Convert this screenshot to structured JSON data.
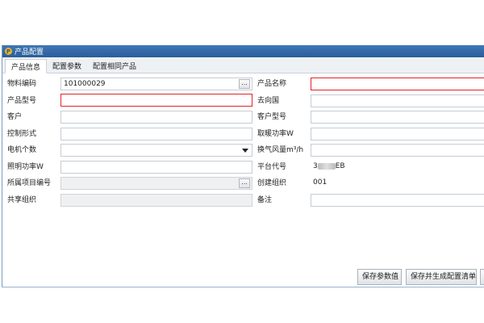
{
  "window": {
    "title": "产品配置",
    "logo_letter": "P"
  },
  "tabs": [
    {
      "label": "产品信息",
      "active": true
    },
    {
      "label": "配置参数",
      "active": false
    },
    {
      "label": "配置相同产品",
      "active": false
    }
  ],
  "fields": {
    "material_code": {
      "label": "物料编码",
      "value": "101000029",
      "button": "..."
    },
    "product_name": {
      "label": "产品名称",
      "value": ""
    },
    "product_model": {
      "label": "产品型号",
      "value": ""
    },
    "destination_country": {
      "label": "去向国",
      "value": ""
    },
    "customer": {
      "label": "客户",
      "value": ""
    },
    "customer_model": {
      "label": "客户型号",
      "value": ""
    },
    "control_form": {
      "label": "控制形式",
      "value": ""
    },
    "heating_power": {
      "label": "取暖功率W",
      "value": ""
    },
    "motor_count": {
      "label": "电机个数",
      "value": ""
    },
    "air_volume": {
      "label": "换气风量m³/h",
      "value": ""
    },
    "lighting_power": {
      "label": "照明功率W",
      "value": ""
    },
    "platform_code": {
      "label": "平台代号",
      "value_prefix": "3",
      "value_suffix": "EB"
    },
    "project_number": {
      "label": "所属项目编号",
      "value": "",
      "button": "..."
    },
    "creating_org": {
      "label": "创建组织",
      "value": "001"
    },
    "shared_org": {
      "label": "共享组织",
      "value": ""
    },
    "remarks": {
      "label": "备注",
      "value": ""
    }
  },
  "buttons": {
    "save_params": "保存参数值",
    "save_generate": "保存并生成配置清单"
  },
  "colors": {
    "titlebar": "#2a5d98",
    "required_border": "#e0252b",
    "logo": "#f2b21c"
  }
}
